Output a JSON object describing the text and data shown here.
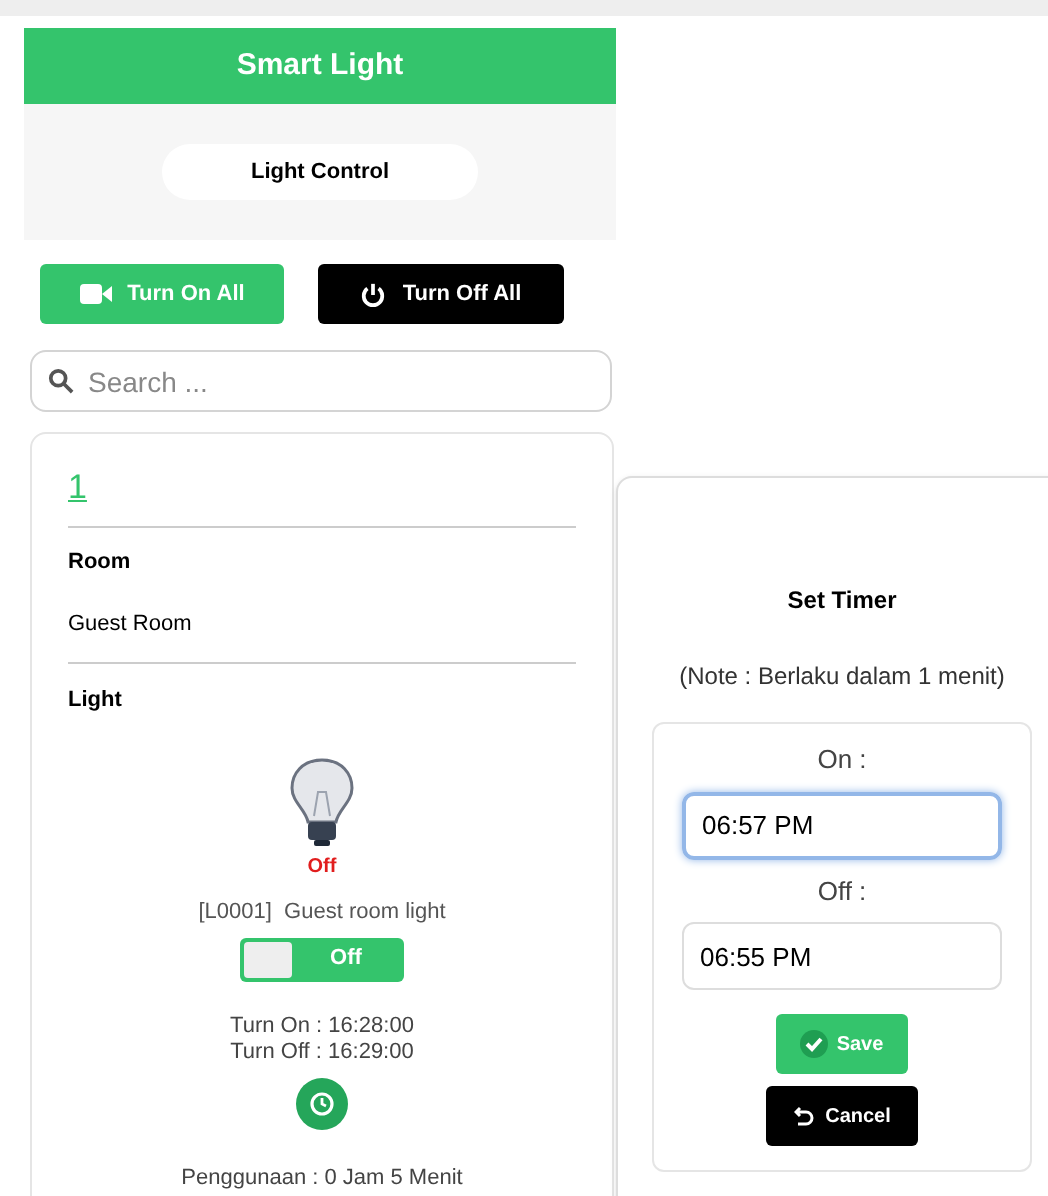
{
  "header": {
    "title": "Smart Light"
  },
  "subheader": {
    "title": "Light Control"
  },
  "actions": [
    {
      "label": "Turn On All",
      "kind": "on"
    },
    {
      "label": "Turn Off All",
      "kind": "off"
    }
  ],
  "search": {
    "placeholder": "Search ..."
  },
  "card": {
    "number": "1",
    "room_label": "Room",
    "room": "Guest Room",
    "light_label": "Light",
    "status": "Off",
    "on": false,
    "device": "[L0001]  Guest room light",
    "switch_label": "Off",
    "turn_on": "Turn On : 16:28:00",
    "turn_off": "Turn Off : 16:29:00",
    "usage": "Penggunaan : 0 Jam 5 Menit"
  },
  "timer": {
    "title": "Set Timer",
    "note": "(Note : Berlaku dalam 1 menit)",
    "fields": [
      {
        "label": "On :",
        "value": "06:57 PM",
        "focused": true
      },
      {
        "label": "Off :",
        "value": "06:55 PM",
        "focused": false
      }
    ],
    "save": "Save",
    "cancel": "Cancel"
  }
}
